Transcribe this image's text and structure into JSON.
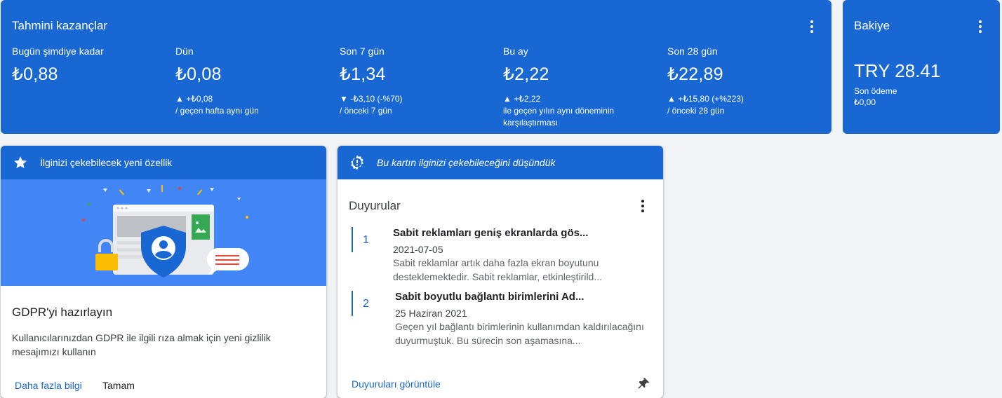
{
  "earnings": {
    "title": "Tahmini kazançlar",
    "metrics": [
      {
        "label": "Bugün şimdiye kadar",
        "value": "₺0,88",
        "change": "",
        "comparison": ""
      },
      {
        "label": "Dün",
        "value": "₺0,08",
        "change": "▲ +₺0,08",
        "comparison": "/ geçen hafta aynı gün"
      },
      {
        "label": "Son 7 gün",
        "value": "₺1,34",
        "change": "▼ -₺3,10 (-%70)",
        "comparison": "/ önceki 7 gün"
      },
      {
        "label": "Bu ay",
        "value": "₺2,22",
        "change": "▲ +₺2,22",
        "comparison": "ile geçen yılın aynı döneminin karşılaştırması"
      },
      {
        "label": "Son 28 gün",
        "value": "₺22,89",
        "change": "▲ +₺15,80 (+%223)",
        "comparison": "/ önceki 28 gün"
      }
    ]
  },
  "balance": {
    "title": "Bakiye",
    "amount": "TRY 28.41",
    "last_payment_label": "Son ödeme",
    "last_payment_value": "₺0,00"
  },
  "feature": {
    "header": "İlginizi çekebilecek yeni özellik",
    "title": "GDPR'yi hazırlayın",
    "description": "Kullanıcılarınızdan GDPR ile ilgili rıza almak için yeni gizlilik mesajımızı kullanın",
    "learn_more": "Daha fazla bilgi",
    "ok": "Tamam"
  },
  "announce": {
    "header": "Bu kartın ilginizi çekebileceğini düşündük",
    "title": "Duyurular",
    "items": [
      {
        "num": "1",
        "title": "Sabit reklamları geniş ekranlarda gös...",
        "date": "2021-07-05",
        "body": "Sabit reklamlar artık daha fazla ekran boyutunu desteklemektedir. Sabit reklamlar, etkinleştirild..."
      },
      {
        "num": "2",
        "title": "Sabit boyutlu bağlantı birimlerini Ad...",
        "date": "25 Haziran 2021",
        "body": "Geçen yıl bağlantı birimlerinin kullanımdan kaldırılacağını duyurmuştuk. Bu sürecin son aşamasına..."
      }
    ],
    "view_all": "Duyuruları görüntüle"
  },
  "colors": {
    "brand_blue": "#1967d2",
    "illustration_blue": "#4285f4"
  }
}
